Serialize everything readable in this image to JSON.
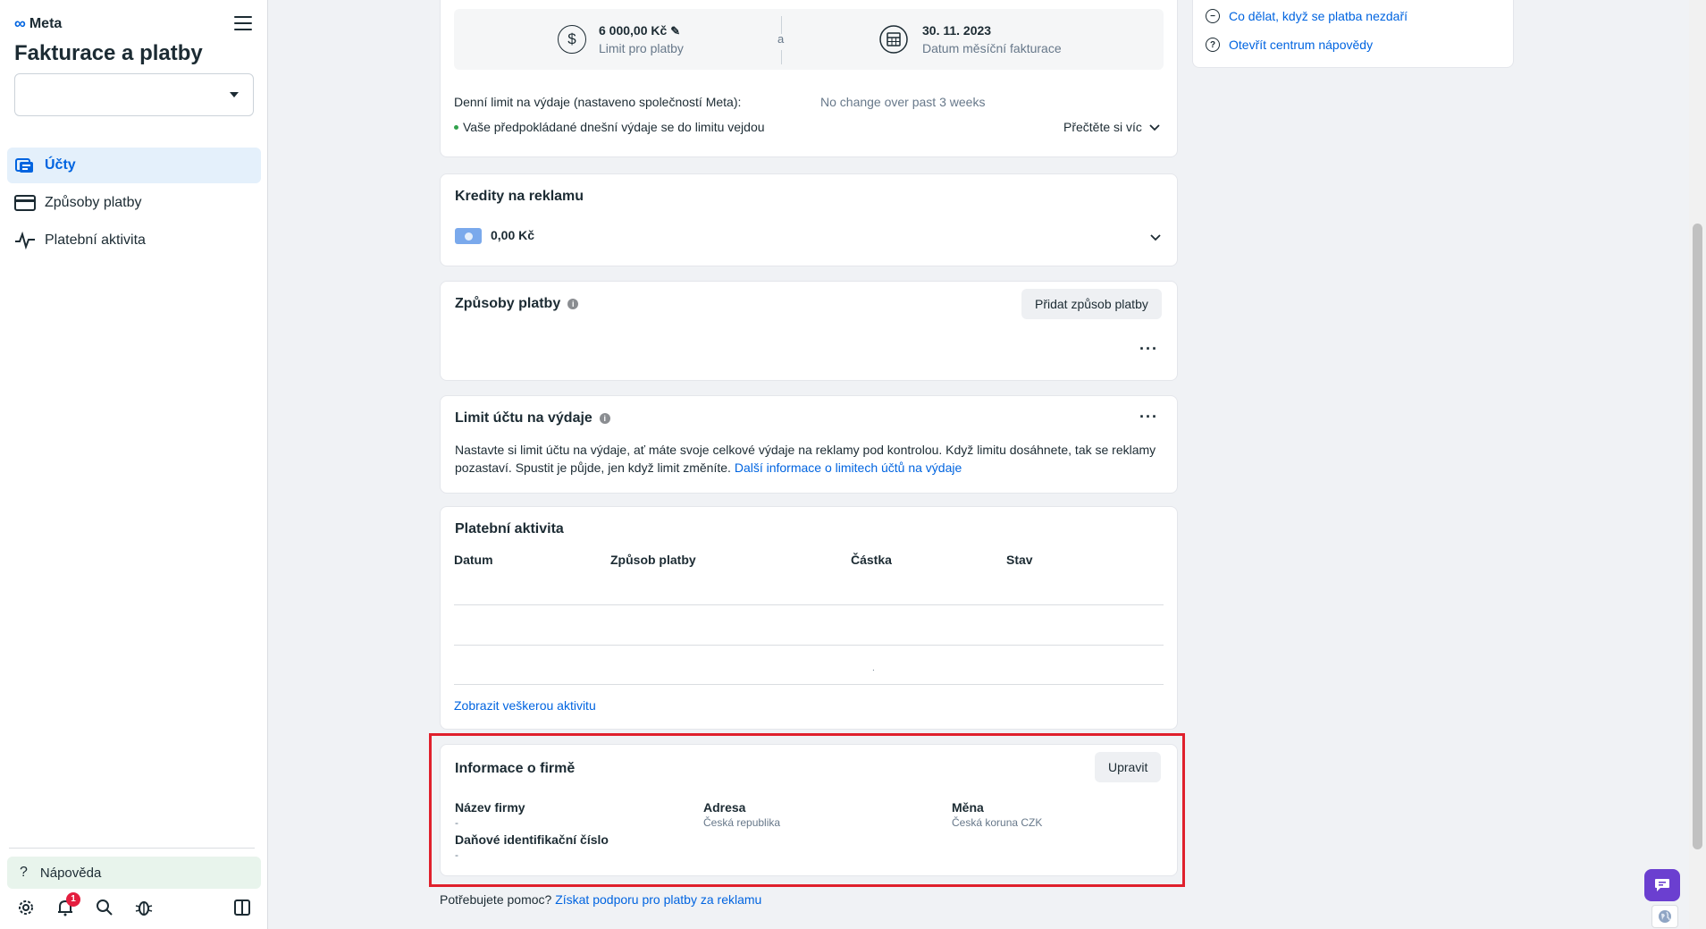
{
  "sidebar": {
    "brand": "Meta",
    "title": "Fakturace a platby",
    "nav": [
      {
        "label": "Účty",
        "icon": "accounts-icon"
      },
      {
        "label": "Způsoby platby",
        "icon": "credit-card-icon"
      },
      {
        "label": "Platební aktivita",
        "icon": "activity-pulse-icon"
      }
    ],
    "help_label": "Nápověda",
    "notification_count": "1"
  },
  "summary": {
    "limit_value": "6 000,00 Kč",
    "limit_label": "Limit pro platby",
    "separator": "a",
    "date_value": "30. 11. 2023",
    "date_label": "Datum měsíční fakturace",
    "daily_limit_label": "Denní limit na výdaje (nastaveno společností Meta):",
    "daily_limit_note": "No change over past 3 weeks",
    "status_text": "Vaše předpokládané dnešní výdaje se do limitu vejdou",
    "read_more": "Přečtěte si víc"
  },
  "credits": {
    "title": "Kredity na reklamu",
    "amount": "0,00 Kč"
  },
  "payment_methods": {
    "title": "Způsoby platby",
    "add_button": "Přidat způsob platby"
  },
  "spend_limit": {
    "title": "Limit účtu na výdaje",
    "text": "Nastavte si limit účtu na výdaje, ať máte svoje celkové výdaje na reklamy pod kontrolou. Když limitu dosáhnete, tak se reklamy pozastaví. Spustit je půjde, jen když limit změníte.",
    "link": "Další informace o limitech účtů na výdaje"
  },
  "activity": {
    "title": "Platební aktivita",
    "columns": [
      "Datum",
      "Způsob platby",
      "Částka",
      "Stav"
    ],
    "dot": ".",
    "view_all": "Zobrazit veškerou aktivitu"
  },
  "business_info": {
    "title": "Informace o firmě",
    "edit_button": "Upravit",
    "name_label": "Název firmy",
    "name_value": "-",
    "tax_label": "Daňové identifikační číslo",
    "tax_value": "-",
    "address_label": "Adresa",
    "address_value": "Česká republika",
    "currency_label": "Měna",
    "currency_value": "Česká koruna CZK"
  },
  "footer": {
    "question": "Potřebujete pomoc?",
    "link": "Získat podporu pro platby za reklamu"
  },
  "right_panel": {
    "items": [
      {
        "label": "Co dělat, když se platba nezdaří",
        "icon": "minus-circle-icon"
      },
      {
        "label": "Otevřít centrum nápovědy",
        "icon": "question-circle-icon"
      }
    ]
  },
  "colors": {
    "accent": "#0064e0",
    "highlight": "#e0202c",
    "success": "#31a24c",
    "chat": "#6b3fd0"
  }
}
